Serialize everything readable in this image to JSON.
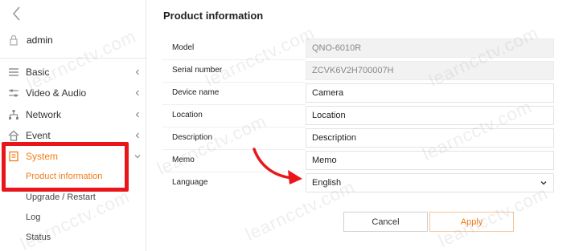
{
  "sidebar": {
    "user": {
      "name": "admin",
      "icon": "lock-icon"
    },
    "items": [
      {
        "label": "Basic",
        "icon": "list-icon"
      },
      {
        "label": "Video & Audio",
        "icon": "sliders-icon"
      },
      {
        "label": "Network",
        "icon": "network-icon"
      },
      {
        "label": "Event",
        "icon": "house-icon"
      },
      {
        "label": "System",
        "icon": "system-icon"
      }
    ],
    "sub_items": [
      "Product information",
      "Upgrade / Restart",
      "Log",
      "Status"
    ]
  },
  "page": {
    "title": "Product information",
    "fields": [
      {
        "label": "Model",
        "value": "QNO-6010R"
      },
      {
        "label": "Serial number",
        "value": "ZCVK6V2H700007H"
      },
      {
        "label": "Device name",
        "value": "Camera"
      },
      {
        "label": "Location",
        "value": "Location"
      },
      {
        "label": "Description",
        "value": "Description"
      },
      {
        "label": "Memo",
        "value": "Memo"
      },
      {
        "label": "Language",
        "value": "English"
      }
    ],
    "buttons": {
      "cancel": "Cancel",
      "apply": "Apply"
    }
  },
  "watermark": "learncctv.com",
  "colors": {
    "accent": "#f07c17",
    "highlight": "#e8161b"
  }
}
